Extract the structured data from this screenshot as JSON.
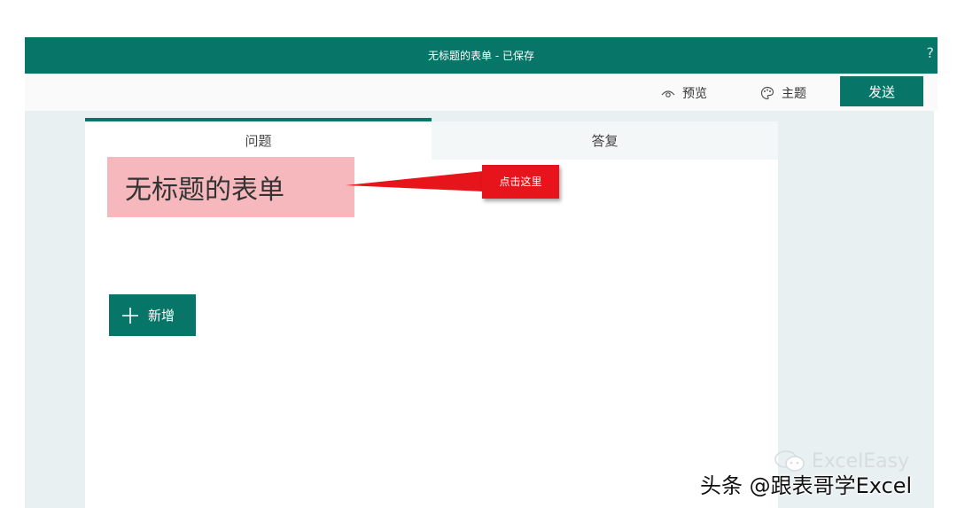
{
  "titlebar": {
    "title": "无标题的表单 - 已保存",
    "help_symbol": "?"
  },
  "toolbar": {
    "preview_label": "预览",
    "theme_label": "主题",
    "send_label": "发送"
  },
  "tabs": [
    {
      "label": "问题"
    },
    {
      "label": "答复"
    }
  ],
  "form": {
    "title": "无标题的表单",
    "add_label": "新增"
  },
  "annotation": {
    "text": "点击这里"
  },
  "watermark": {
    "brand": "ExcelEasy",
    "credit": "头条 @跟表哥学Excel"
  },
  "colors": {
    "accent": "#077568",
    "annotation": "#e8141c",
    "title_highlight": "#f6b8bd",
    "background": "#e9f0f2"
  }
}
